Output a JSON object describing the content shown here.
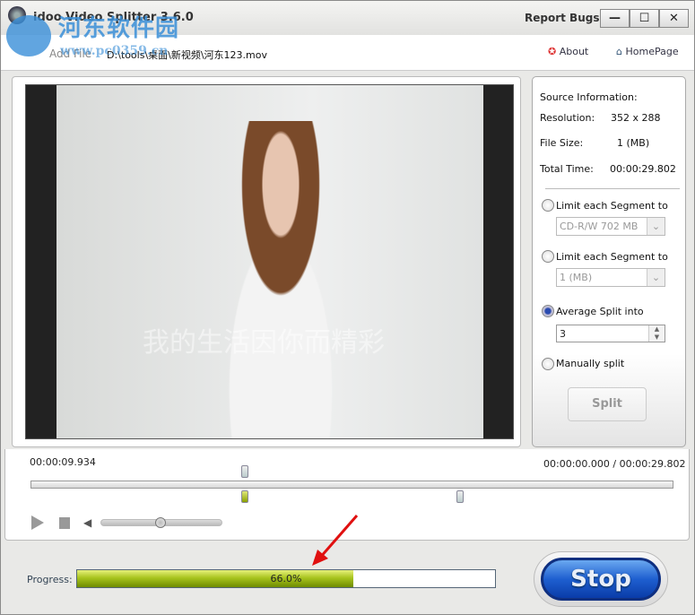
{
  "window": {
    "title": "idoo Video Splitter 3.6.0",
    "report_bugs": "Report Bugs",
    "minimize": "—",
    "maximize": "☐",
    "close": "✕"
  },
  "watermark": {
    "text": "河东软件园",
    "url": "www.pc0359.cn"
  },
  "toolbar": {
    "add_file": "Add File",
    "file_path": "D:\\tools\\桌面\\新视频\\河东123.mov",
    "about": "About",
    "homepage": "HomePage"
  },
  "video": {
    "overlay_text": "我的生活因你而精彩"
  },
  "source": {
    "header": "Source Information:",
    "resolution_label": "Resolution:",
    "resolution": "352 x 288",
    "filesize_label": "File Size:",
    "filesize": "1 (MB)",
    "total_time_label": "Total Time:",
    "total_time": "00:00:29.802"
  },
  "options": [
    {
      "label": "Limit each Segment to",
      "selected": false,
      "value": "CD-R/W 702 MB"
    },
    {
      "label": "Limit each Segment to",
      "selected": false,
      "value": "1 (MB)"
    },
    {
      "label": "Average Split into",
      "selected": true,
      "value": "3"
    },
    {
      "label": "Manually split",
      "selected": false
    }
  ],
  "split_button": "Split",
  "timeline": {
    "current": "00:00:09.934",
    "position": "00:00:00.000 / 00:00:29.802"
  },
  "progress": {
    "label": "Progress:",
    "text": "66.0%",
    "value": 66.0,
    "color": "#8aaa10"
  },
  "stop_button": "Stop"
}
